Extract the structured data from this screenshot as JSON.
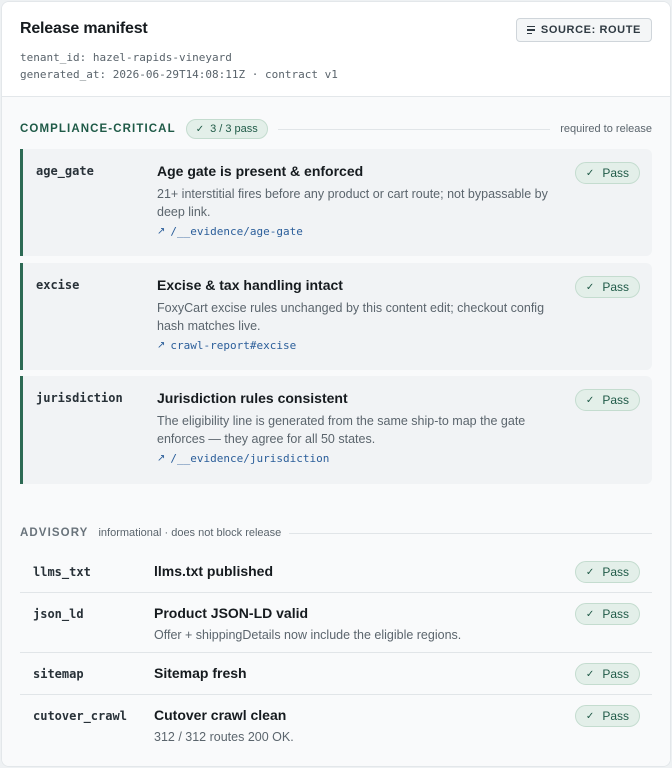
{
  "header": {
    "title": "Release manifest",
    "tenant_line": "tenant_id: hazel-rapids-vineyard",
    "generated_line": "generated_at: 2026-06-29T14:08:11Z · contract v1",
    "source_button": "SOURCE: ROUTE"
  },
  "critical": {
    "title": "COMPLIANCE-CRITICAL",
    "count": "3 / 3 pass",
    "note": "required to release",
    "items": [
      {
        "key": "age_gate",
        "title": "Age gate is present & enforced",
        "desc": "21+ interstitial fires before any product or cart route; not bypassable by deep link.",
        "link": "/__evidence/age-gate",
        "status": "Pass"
      },
      {
        "key": "excise",
        "title": "Excise & tax handling intact",
        "desc": "FoxyCart excise rules unchanged by this content edit; checkout config hash matches live.",
        "link": "crawl-report#excise",
        "status": "Pass"
      },
      {
        "key": "jurisdiction",
        "title": "Jurisdiction rules consistent",
        "desc": "The eligibility line is generated from the same ship-to map the gate enforces — they agree for all 50 states.",
        "link": "/__evidence/jurisdiction",
        "status": "Pass"
      }
    ]
  },
  "advisory": {
    "title": "ADVISORY",
    "note": "informational · does not block release",
    "items": [
      {
        "key": "llms_txt",
        "title": "llms.txt published",
        "desc": "",
        "status": "Pass"
      },
      {
        "key": "json_ld",
        "title": "Product JSON-LD valid",
        "desc": "Offer + shippingDetails now include the eligible regions.",
        "status": "Pass"
      },
      {
        "key": "sitemap",
        "title": "Sitemap fresh",
        "desc": "",
        "status": "Pass"
      },
      {
        "key": "cutover_crawl",
        "title": "Cutover crawl clean",
        "desc": "312 / 312 routes 200 OK.",
        "status": "Pass"
      }
    ]
  },
  "colors": {
    "accent": "#2d6a54",
    "pass_bg": "#e3efe9",
    "link": "#2b5e9a"
  },
  "icons": {
    "source_button": "list-lines-icon",
    "pass": "check-icon",
    "link": "arrow-up-right-icon"
  }
}
